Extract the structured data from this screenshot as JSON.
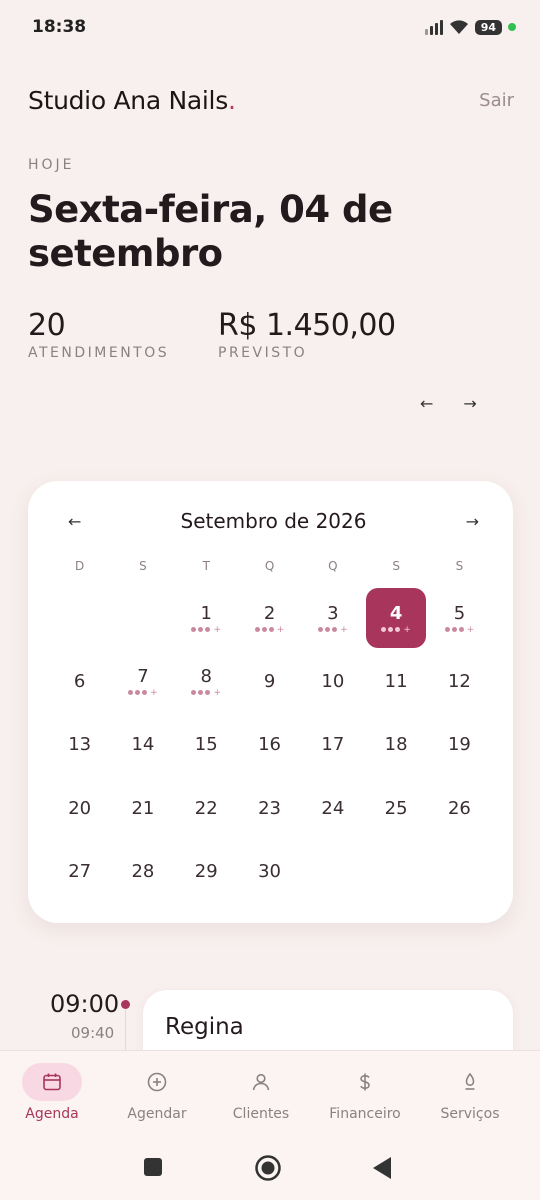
{
  "status_bar": {
    "time": "18:38",
    "battery": "94"
  },
  "header": {
    "brand": "Studio Ana Nails",
    "brand_dot": ".",
    "logout": "Sair"
  },
  "today": {
    "label": "HOJE",
    "date": "Sexta-feira, 04 de setembro"
  },
  "stats": [
    {
      "value": "20",
      "label": "ATENDIMENTOS"
    },
    {
      "value": "R$ 1.450,00",
      "label": "PREVISTO"
    }
  ],
  "day_nav": {
    "prev": "←",
    "next": "→"
  },
  "calendar": {
    "title": "Setembro de 2026",
    "prev": "←",
    "next": "→",
    "weekdays": [
      "D",
      "S",
      "T",
      "Q",
      "Q",
      "S",
      "S"
    ],
    "days": [
      {
        "n": "",
        "dots": false
      },
      {
        "n": "",
        "dots": false
      },
      {
        "n": "1",
        "dots": true
      },
      {
        "n": "2",
        "dots": true
      },
      {
        "n": "3",
        "dots": true
      },
      {
        "n": "4",
        "dots": true,
        "selected": true
      },
      {
        "n": "5",
        "dots": true
      },
      {
        "n": "6",
        "dots": false
      },
      {
        "n": "7",
        "dots": true
      },
      {
        "n": "8",
        "dots": true
      },
      {
        "n": "9",
        "dots": false
      },
      {
        "n": "10",
        "dots": false
      },
      {
        "n": "11",
        "dots": false
      },
      {
        "n": "12",
        "dots": false
      },
      {
        "n": "13",
        "dots": false
      },
      {
        "n": "14",
        "dots": false
      },
      {
        "n": "15",
        "dots": false
      },
      {
        "n": "16",
        "dots": false
      },
      {
        "n": "17",
        "dots": false
      },
      {
        "n": "18",
        "dots": false
      },
      {
        "n": "19",
        "dots": false
      },
      {
        "n": "20",
        "dots": false
      },
      {
        "n": "21",
        "dots": false
      },
      {
        "n": "22",
        "dots": false
      },
      {
        "n": "23",
        "dots": false
      },
      {
        "n": "24",
        "dots": false
      },
      {
        "n": "25",
        "dots": false
      },
      {
        "n": "26",
        "dots": false
      },
      {
        "n": "27",
        "dots": false
      },
      {
        "n": "28",
        "dots": false
      },
      {
        "n": "29",
        "dots": false
      },
      {
        "n": "30",
        "dots": false
      }
    ],
    "more_marker": "+"
  },
  "agenda": {
    "start": "09:00",
    "end": "09:40",
    "client": "Regina"
  },
  "bottom_nav": [
    {
      "label": "Agenda",
      "icon": "calendar-icon",
      "active": true
    },
    {
      "label": "Agendar",
      "icon": "plus-circle-icon",
      "active": false
    },
    {
      "label": "Clientes",
      "icon": "person-icon",
      "active": false
    },
    {
      "label": "Financeiro",
      "icon": "dollar-icon",
      "active": false
    },
    {
      "label": "Serviços",
      "icon": "drop-icon",
      "active": false
    }
  ],
  "colors": {
    "accent": "#a8355c",
    "background": "#f8f0ee",
    "muted": "#8c8084",
    "card": "#ffffff"
  }
}
